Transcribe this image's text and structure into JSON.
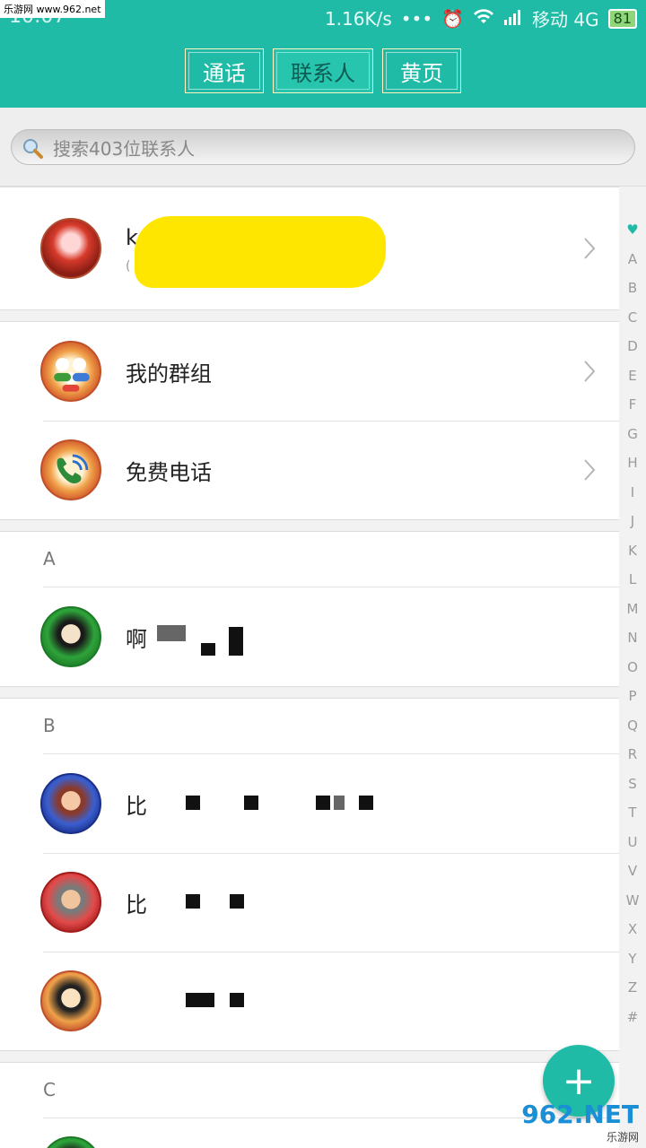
{
  "watermark": "乐游网 www.962.net",
  "status": {
    "time": "10:07",
    "speed": "1.16K/s",
    "dots": "•••",
    "carrier": "移动 4G",
    "battery": "81"
  },
  "tabs": [
    {
      "label": "通话"
    },
    {
      "label": "联系人"
    },
    {
      "label": "黄页"
    }
  ],
  "search": {
    "placeholder": "搜索403位联系人"
  },
  "me": {
    "name_initial": "k",
    "sub_initial": "("
  },
  "features": [
    {
      "label": "我的群组",
      "icon": "group-icon"
    },
    {
      "label": "免费电话",
      "icon": "free-call-icon"
    }
  ],
  "sections": [
    {
      "letter": "A",
      "contacts": [
        {
          "name": "啊"
        }
      ]
    },
    {
      "letter": "B",
      "contacts": [
        {
          "name": "比"
        },
        {
          "name": "比"
        },
        {
          "name": ""
        }
      ]
    },
    {
      "letter": "C",
      "contacts": []
    }
  ],
  "index": [
    "♥",
    "A",
    "B",
    "C",
    "D",
    "E",
    "F",
    "G",
    "H",
    "I",
    "J",
    "K",
    "L",
    "M",
    "N",
    "O",
    "P",
    "Q",
    "R",
    "S",
    "T",
    "U",
    "V",
    "W",
    "X",
    "Y",
    "Z",
    "#"
  ],
  "fab": {
    "label": "+"
  },
  "logo": {
    "main": "962.NET",
    "sub": "乐游网"
  },
  "colors": {
    "accent": "#1fbba6",
    "highlight": "#ffe600"
  }
}
